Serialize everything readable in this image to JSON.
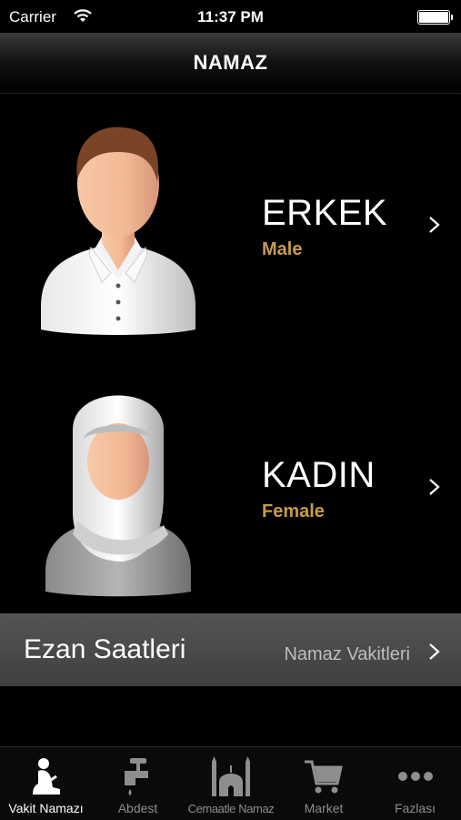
{
  "status_bar": {
    "carrier": "Carrier",
    "time": "11:37 PM"
  },
  "nav": {
    "title": "NAMAZ"
  },
  "rows": {
    "male": {
      "title": "ERKEK",
      "subtitle": "Male",
      "icon": "man-avatar-icon"
    },
    "female": {
      "title": "KADIN",
      "subtitle": "Female",
      "icon": "woman-avatar-icon"
    }
  },
  "ezan": {
    "title": "Ezan Saatleri",
    "detail": "Namaz Vakitleri"
  },
  "tabs": [
    {
      "label": "Vakit Namazı",
      "icon": "praying-person-icon",
      "active": true
    },
    {
      "label": "Abdest",
      "icon": "water-tap-icon",
      "active": false
    },
    {
      "label": "Cemaatle Namaz",
      "icon": "mosque-icon",
      "active": false
    },
    {
      "label": "Market",
      "icon": "shopping-cart-icon",
      "active": false
    },
    {
      "label": "Fazlası",
      "icon": "more-dots-icon",
      "active": false
    }
  ],
  "colors": {
    "background": "#000000",
    "accent": "#c89b4a",
    "ezan_row": "#4a4a4a",
    "tab_inactive": "#8e8e8e"
  }
}
